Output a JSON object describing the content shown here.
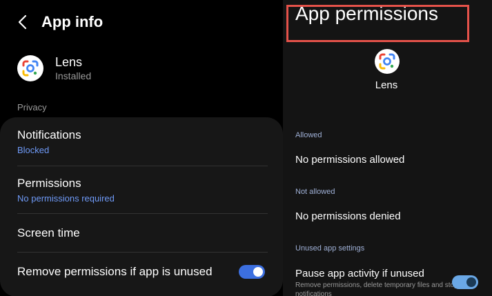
{
  "app_info": {
    "title": "App info",
    "app_name": "Lens",
    "app_status": "Installed",
    "section_privacy": "Privacy",
    "notifications": {
      "title": "Notifications",
      "subtitle": "Blocked"
    },
    "permissions": {
      "title": "Permissions",
      "subtitle": "No permissions required"
    },
    "screen_time": {
      "title": "Screen time"
    },
    "remove_permissions": {
      "title": "Remove permissions if app is unused",
      "enabled": true
    }
  },
  "app_permissions": {
    "title": "App permissions",
    "app_name": "Lens",
    "allowed_header": "Allowed",
    "allowed_value": "No permissions allowed",
    "not_allowed_header": "Not allowed",
    "not_allowed_value": "No permissions denied",
    "unused_header": "Unused app settings",
    "pause_title": "Pause app activity if unused",
    "pause_subtitle": "Remove permissions, delete temporary files and stop notifications",
    "pause_enabled": true
  },
  "colors": {
    "accent": "#3c6fe0",
    "subtitle_blue": "#6f9af7",
    "highlight_red": "#e5524a"
  },
  "icons": [
    "back-arrow-icon",
    "lens-app-icon"
  ]
}
